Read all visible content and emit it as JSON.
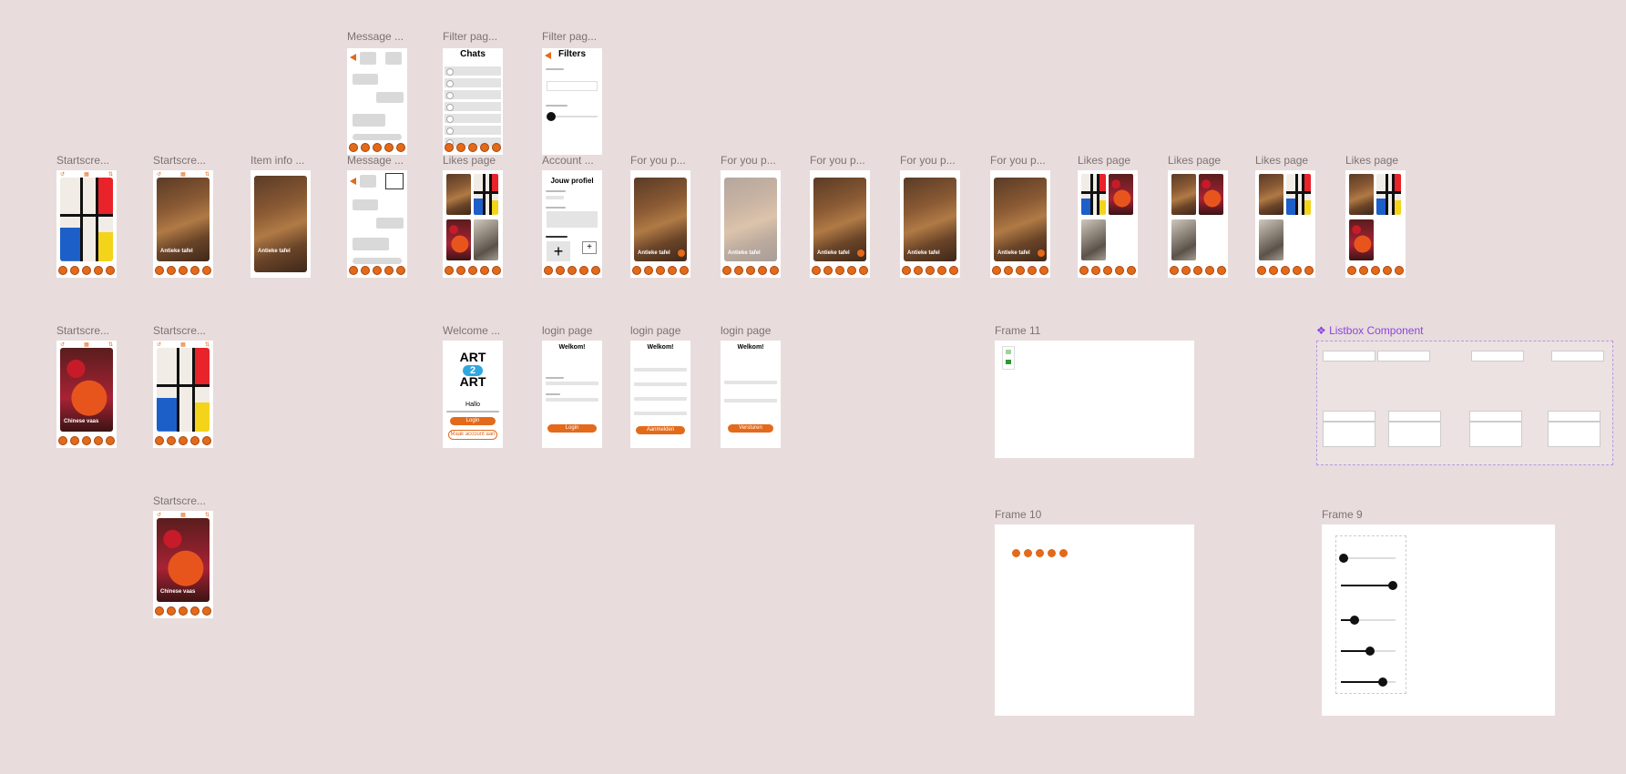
{
  "canvas": {
    "background": "#e8dcdc",
    "accent": "#e36a1a",
    "component_color": "#8a45e0"
  },
  "frame_labels": {
    "message_1": "Message ...",
    "filter_1": "Filter pag...",
    "filter_2": "Filter pag...",
    "startscreen_1": "Startscre...",
    "startscreen_2": "Startscre...",
    "item_info": "Item info ...",
    "message_2": "Message ...",
    "likes_1": "Likes page",
    "account": "Account ...",
    "foryou_1": "For you p...",
    "foryou_2": "For you p...",
    "foryou_3": "For you p...",
    "foryou_4": "For you p...",
    "foryou_5": "For you p...",
    "likes_2": "Likes page",
    "likes_3": "Likes page",
    "likes_4": "Likes page",
    "likes_5": "Likes page",
    "startscreen_3": "Startscre...",
    "startscreen_4": "Startscre...",
    "welcome": "Welcome ...",
    "login_1": "login page",
    "login_2": "login page",
    "login_3": "login page",
    "frame_11": "Frame 11",
    "listbox_component": "❖ Listbox Component",
    "startscreen_5": "Startscre...",
    "frame_10": "Frame 10",
    "frame_9": "Frame 9"
  },
  "screens": {
    "chats_title": "Chats",
    "filters_title": "Filters",
    "profile_title": "Jouw profiel",
    "item_antique_table": "Antieke tafel",
    "item_chinese_vase": "Chinese vaas",
    "welcome_logo_top": "ART",
    "welcome_logo_mid": "2",
    "welcome_logo_bottom": "ART",
    "welcome_greeting": "Hallo",
    "welcome_login_button": "Login",
    "welcome_create_account": "Maak account aan",
    "login_heading": "Welkom!",
    "login_button": "Login",
    "register_button": "Aanmelden",
    "send_button": "Versturen"
  }
}
